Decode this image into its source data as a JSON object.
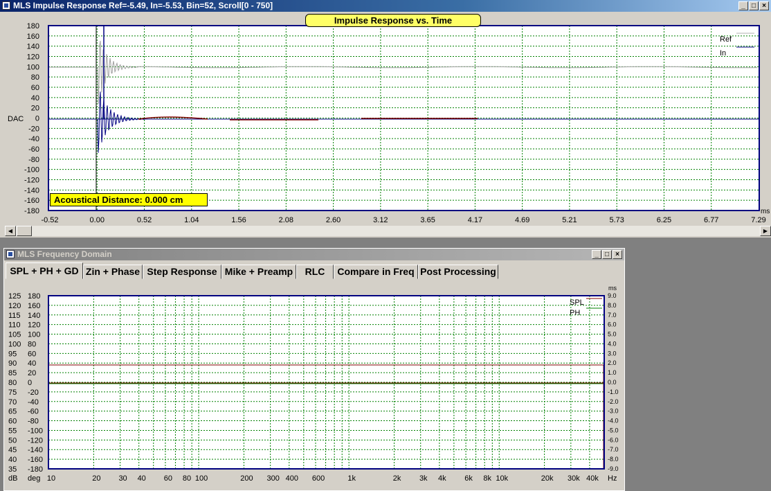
{
  "impulse_window": {
    "title": "MLS Impulse Response  Ref=-5.49, In=-5.53, Bin=52, Scroll[0 - 750]",
    "plot_title": "Impulse Response vs. Time",
    "distance_label": "Acoustical Distance: 0.000 cm",
    "y_unit": "DAC",
    "x_unit": "ms",
    "y_ticks": [
      "180",
      "160",
      "140",
      "120",
      "100",
      "80",
      "60",
      "40",
      "20",
      "0",
      "-20",
      "-40",
      "-60",
      "-80",
      "-100",
      "-120",
      "-140",
      "-160",
      "-180"
    ],
    "x_ticks": [
      "-0.52",
      "0.00",
      "0.52",
      "1.04",
      "1.56",
      "2.08",
      "2.60",
      "3.12",
      "3.65",
      "4.17",
      "4.69",
      "5.21",
      "5.73",
      "6.25",
      "6.77",
      "7.29"
    ],
    "legend": [
      {
        "name": "Ref",
        "color": "#b0b0b0"
      },
      {
        "name": "In",
        "color": "#000080"
      }
    ],
    "buttons": {
      "minimize": "_",
      "restore": "□",
      "close": "×"
    }
  },
  "freq_window": {
    "title": "MLS Frequency Domain",
    "tabs": [
      "SPL + PH + GD",
      "Zin + Phase",
      "Step Response",
      "Mike + Preamp",
      "RLC",
      "Compare in Freq",
      "Post Processing"
    ],
    "active_tab": 0,
    "db_ticks": [
      "125",
      "120",
      "115",
      "110",
      "105",
      "100",
      "95",
      "90",
      "85",
      "80",
      "75",
      "70",
      "65",
      "60",
      "55",
      "50",
      "45",
      "40",
      "35"
    ],
    "deg_ticks": [
      "180",
      "160",
      "140",
      "120",
      "100",
      "80",
      "60",
      "40",
      "20",
      "0",
      "-20",
      "-40",
      "-60",
      "-80",
      "-100",
      "-120",
      "-140",
      "-160",
      "-180"
    ],
    "ms_ticks": [
      "9.0",
      "8.0",
      "7.0",
      "6.0",
      "5.0",
      "4.0",
      "3.0",
      "2.0",
      "1.0",
      "0.0",
      "-1.0",
      "-2.0",
      "-3.0",
      "-4.0",
      "-5.0",
      "-6.0",
      "-7.0",
      "-8.0",
      "-9.0"
    ],
    "x_ticks": [
      "10",
      "20",
      "30",
      "40",
      "60",
      "80",
      "100",
      "200",
      "300",
      "400",
      "600",
      "1k",
      "2k",
      "3k",
      "4k",
      "6k",
      "8k",
      "10k",
      "20k",
      "30k",
      "40k"
    ],
    "db_unit": "dB",
    "deg_unit": "deg",
    "hz_unit": "Hz",
    "ms_unit": "ms",
    "legend": [
      {
        "name": "SPL",
        "color": "#800000"
      },
      {
        "name": "PH",
        "color": "#008000"
      }
    ],
    "buttons": {
      "minimize": "_",
      "restore": "□",
      "close": "×"
    }
  },
  "colors": {
    "titlebar_active": "#0a246a",
    "titlebar_inactive": "#808080",
    "plot_border": "#000080",
    "grid": "#008000"
  }
}
